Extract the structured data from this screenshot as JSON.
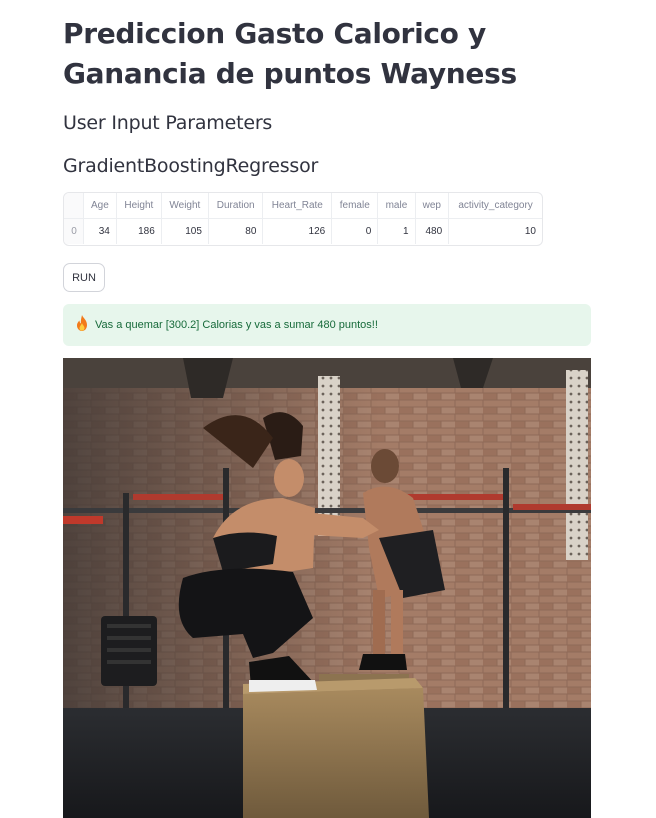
{
  "title": "Prediccion Gasto Calorico y Ganancia de puntos Wayness",
  "subheader_params": "User Input Parameters",
  "subheader_model": "GradientBoostingRegressor",
  "table": {
    "columns": [
      "",
      "Age",
      "Height",
      "Weight",
      "Duration",
      "Heart_Rate",
      "female",
      "male",
      "wep",
      "activity_category"
    ],
    "rows": [
      [
        "0",
        "34",
        "186",
        "105",
        "80",
        "126",
        "0",
        "1",
        "480",
        "10"
      ]
    ]
  },
  "run_label": "RUN",
  "result": {
    "icon": "fire-icon",
    "text": "Vas a quemar [300.2] Calorias y vas a sumar 480 puntos!!"
  },
  "image": {
    "kind": "photo",
    "alt": "box-jump-workout-photo"
  },
  "colors": {
    "success_bg": "#e7f6ec",
    "success_text": "#176a3a",
    "text": "#31333F"
  }
}
